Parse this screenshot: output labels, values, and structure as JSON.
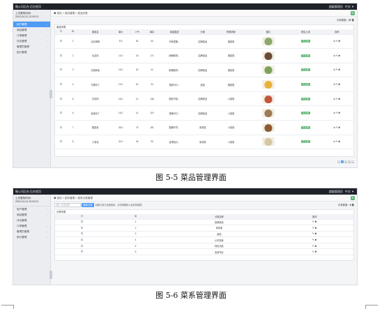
{
  "figure1": {
    "header": {
      "left": "微公司后台    后台首页",
      "right_user": "超级管理员",
      "right_extra": "中文   ▼"
    },
    "sidebar": {
      "login_label": "上次登陆时间:",
      "login_time": "2022-04-21 22:00:21",
      "items": [
        {
          "label": "用户管理",
          "active": true
        },
        {
          "label": "商品管理",
          "active": false
        },
        {
          "label": "订单管理",
          "active": false
        },
        {
          "label": "评论管理",
          "active": false
        },
        {
          "label": "管理员管理",
          "active": false
        },
        {
          "label": "统计管理",
          "active": false
        }
      ]
    },
    "breadcrumb": "◆ 首页  >  菜品管理  >  菜品列表",
    "add_button": "+ 添加菜品",
    "total_label": "共有数据：",
    "total_value": "27 条",
    "panel_title": "菜品列表",
    "columns": [
      "",
      "ID",
      "菜品名",
      "单价",
      "人气",
      "库存",
      "菜品描述",
      "分类",
      "所属商家",
      "图片",
      "是否上线",
      "操作"
    ],
    "rows": [
      {
        "id": "1",
        "name": "北京烤鸭",
        "price": "8.5",
        "pop": "54",
        "stock": "64",
        "desc": "外焦里嫩...",
        "cat": "招牌菜品",
        "shop": "湘菜馆",
        "status": "已上线",
        "img": "#8aa86a"
      },
      {
        "id": "2",
        "name": "毛血旺",
        "price": "13.0",
        "pop": "18",
        "stock": "171",
        "desc": "麻辣鲜香...",
        "cat": "招牌菜品",
        "shop": "湘菜馆",
        "status": "已上线",
        "img": "#6b4a34"
      },
      {
        "id": "3",
        "name": "清蒸鲈鱼",
        "price": "16.0",
        "pop": "40",
        "stock": "42",
        "desc": "鲜嫩爽滑...",
        "cat": "招牌菜品",
        "shop": "湘菜馆",
        "status": "已上线",
        "img": "#7fa25a"
      },
      {
        "id": "4",
        "name": "芒果布丁",
        "price": "13.0",
        "pop": "61",
        "stock": "34",
        "desc": "香甜可口...",
        "cat": "甜品",
        "shop": "湘菜馆",
        "status": "已上线",
        "img": "#e8b13c"
      },
      {
        "id": "5",
        "name": "红烧肉",
        "price": "18.0",
        "pop": "12",
        "stock": "158",
        "desc": "肥而不腻...",
        "cat": "招牌菜品",
        "shop": "川菜馆",
        "status": "已上线",
        "img": "#c2563a"
      },
      {
        "id": "6",
        "name": "宫保鸡丁",
        "price": "18.0",
        "pop": "14",
        "stock": "119",
        "desc": "香辣可口...",
        "cat": "招牌菜品",
        "shop": "川菜馆",
        "status": "已上线",
        "img": "#9b7a55"
      },
      {
        "id": "7",
        "name": "酸菜鱼",
        "price": "38.0",
        "pop": "75",
        "stock": "181",
        "desc": "酸辣开胃...",
        "cat": "家常菜",
        "shop": "川菜馆",
        "status": "已上线",
        "img": "#8c5a35"
      },
      {
        "id": "8",
        "name": "小笼包",
        "price": "30.0",
        "pop": "45",
        "stock": "96",
        "desc": "皮薄馅大...",
        "cat": "家常菜",
        "shop": "川菜馆",
        "status": "已上线",
        "img": "#d4c9a2"
      }
    ],
    "pager": [
      "«",
      "1",
      "2",
      "3",
      "»"
    ],
    "caption": "图 5-5 菜品管理界面"
  },
  "figure2": {
    "header": {
      "left": "微公司后台    后台首页",
      "right_user": "超级管理员",
      "right_extra": "中文   ▼"
    },
    "sidebar": {
      "login_label": "上次登陆时间:",
      "login_time": "2022-04-21 22:00:21",
      "items": [
        {
          "label": "用户管理",
          "active": false
        },
        {
          "label": "商品管理",
          "active": false
        },
        {
          "label": "评论管理",
          "active": false
        },
        {
          "label": "订单管理",
          "active": false
        },
        {
          "label": "管理员管理",
          "active": false
        },
        {
          "label": "统计管理",
          "active": false
        }
      ]
    },
    "breadcrumb": "◆ 首页  >  菜系管理  >  菜系分类管理",
    "search_placeholder": "输入分类名称",
    "search_button": "搜索分类",
    "hint": "如果分类已经被使用，请谨慎删除以免影响数据",
    "total_label": "共有数据：",
    "total_value": "6 条",
    "panel_title": "分类列表",
    "columns": [
      "",
      "ID",
      "分类名称",
      "操作"
    ],
    "rows": [
      {
        "id": "1",
        "name": "招牌菜品"
      },
      {
        "id": "2",
        "name": "家常菜"
      },
      {
        "id": "3",
        "name": "甜品"
      },
      {
        "id": "4",
        "name": "小吃零食"
      },
      {
        "id": "5",
        "name": "特色汤品"
      },
      {
        "id": "6",
        "name": "素食专区"
      }
    ],
    "caption": "图 5-6 菜系管理界面"
  }
}
